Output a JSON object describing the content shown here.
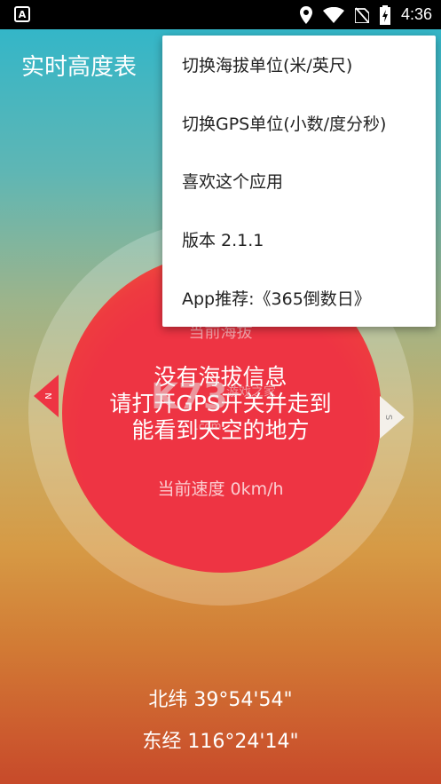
{
  "status_bar": {
    "time": "4:36",
    "icons": [
      "notification-a-icon",
      "location-icon",
      "wifi-icon",
      "no-sim-icon",
      "battery-charging-icon"
    ]
  },
  "app": {
    "title": "实时高度表"
  },
  "gauge": {
    "altitude_label": "当前海拔",
    "message_lines": [
      "没有海拔信息",
      "请打开GPS开关并走到",
      "能看到天空的地方"
    ],
    "speed_text": "当前速度 0km/h",
    "north_letter": "N",
    "south_letter": "S"
  },
  "location": {
    "latitude": "北纬 39°54'54\"",
    "longitude": "东经 116°24'14\""
  },
  "menu": {
    "items": [
      "切换海拔单位(米/英尺)",
      "切换GPS单位(小数/度分秒)",
      "喜欢这个应用",
      "版本 2.1.1",
      "App推荐:《365倒数日》"
    ]
  },
  "colors": {
    "disc_red": "#ee3443",
    "menu_bg": "#ffffff",
    "status_bar_bg": "#000000"
  }
}
